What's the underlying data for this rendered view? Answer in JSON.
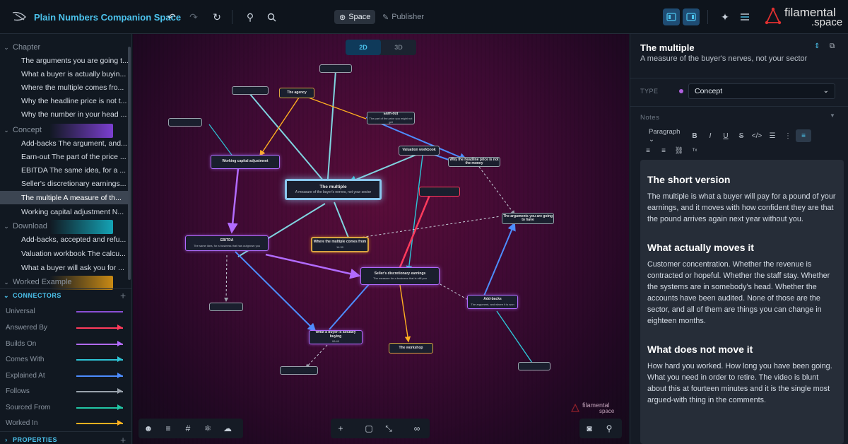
{
  "app": {
    "title": "Plain Numbers Companion Space"
  },
  "modes": {
    "space": "Space",
    "publisher": "Publisher"
  },
  "brand": {
    "line1": "filamental",
    "line2": ".space"
  },
  "sidebar": {
    "categories": [
      {
        "label": "Chapter",
        "items": [
          "The arguments you are going t...",
          "What a buyer is actually buyin...",
          "Where the multiple comes fro...",
          "Why the headline price is not t...",
          "Why the number in your head ..."
        ]
      },
      {
        "label": "Concept",
        "items": [
          "Add-backs The argument, and...",
          "Earn-out The part of the price ...",
          "EBITDA The same idea, for a ...",
          "Seller's discretionary earnings...",
          "The multiple A measure of th...",
          "Working capital adjustment N..."
        ]
      },
      {
        "label": "Download",
        "items": [
          "Add-backs, accepted and refu...",
          "Valuation workbook The calcu...",
          "What a buyer will ask you for ..."
        ]
      },
      {
        "label": "Worked Example",
        "items": []
      }
    ],
    "connectors_label": "CONNECTORS",
    "connectors": [
      {
        "label": "Universal",
        "color": "#8a4fd6"
      },
      {
        "label": "Answered By",
        "color": "#ff3b5c"
      },
      {
        "label": "Builds On",
        "color": "#b26bff"
      },
      {
        "label": "Comes With",
        "color": "#2ec4d6"
      },
      {
        "label": "Explained At",
        "color": "#4d8dff"
      },
      {
        "label": "Follows",
        "color": "#9aa3ad"
      },
      {
        "label": "Sourced From",
        "color": "#22c7a5"
      },
      {
        "label": "Worked In",
        "color": "#ffb020"
      }
    ],
    "properties_label": "PROPERTIES"
  },
  "canvas": {
    "dim_2d": "2D",
    "dim_3d": "3D",
    "watermark_line1": "filamental",
    "watermark_line2": "space",
    "nodes": [
      {
        "title": "The multiple",
        "sub": "A measure of the buyer's nerves, not your sector"
      },
      {
        "title": "EBITDA",
        "sub": "The same idea, for a business that has outgrown you"
      },
      {
        "title": "Working capital adjustment",
        "sub": ""
      },
      {
        "title": "Where the multiple comes from",
        "sub": "14:30"
      },
      {
        "title": "Seller's discretionary earnings",
        "sub": "The measure for a business that is still you"
      },
      {
        "title": "What a buyer is actually buying",
        "sub": "06:40"
      },
      {
        "title": "Add-backs",
        "sub": "The argument, and where it is won"
      },
      {
        "title": "The arguments you are going to have",
        "sub": ""
      },
      {
        "title": "Earn-out",
        "sub": "The part of the price you might not get"
      },
      {
        "title": "Valuation workbook",
        "sub": ""
      },
      {
        "title": "Why the headline price is not the money",
        "sub": ""
      },
      {
        "title": "The agency",
        "sub": ""
      },
      {
        "title": "The workshop",
        "sub": ""
      }
    ]
  },
  "panel": {
    "title": "The multiple",
    "subtitle": "A measure of the buyer's nerves, not your sector",
    "type_label": "TYPE",
    "type_value": "Concept",
    "notes_label": "Notes",
    "paragraph_label": "Paragraph",
    "sections": [
      {
        "heading": "The short version",
        "body": "The multiple is what a buyer will pay for a pound of your earnings, and it moves with how confident they are that the pound arrives again next year without you."
      },
      {
        "heading": "What actually moves it",
        "body": "Customer concentration. Whether the revenue is contracted or hopeful. Whether the staff stay. Whether the systems are in somebody's head. Whether the accounts have been audited. None of those are the sector, and all of them are things you can change in eighteen months."
      },
      {
        "heading": "What does not move it",
        "body": "How hard you worked. How long you have been going. What you need in order to retire. The video is blunt about this at fourteen minutes and it is the single most argued-with thing in the comments."
      }
    ]
  }
}
